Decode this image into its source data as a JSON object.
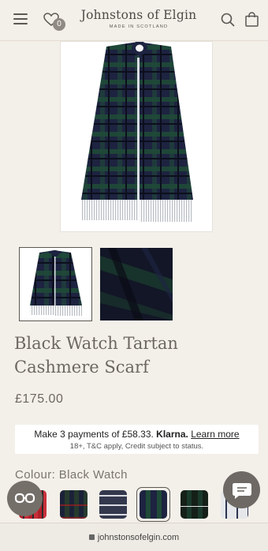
{
  "header": {
    "brand": "Johnstons of Elgin",
    "tagline": "MADE IN SCOTLAND",
    "wishlist_count": "0"
  },
  "product": {
    "title_line1": "Black Watch Tartan",
    "title_line2": "Cashmere Scarf",
    "price": "£175.00"
  },
  "klarna": {
    "prefix": "Make 3 payments of £58.33. ",
    "brand": "Klarna.",
    "link": "Learn more",
    "disclaimer": "18+, T&C apply, Credit subject to status."
  },
  "colour": {
    "label": "Colour: Black Watch"
  },
  "browser": {
    "url": "johnstonsofelgin.com"
  },
  "colors": {
    "background": "#f3efe9",
    "text": "#6c6761",
    "tartan_navy": "#1d2340",
    "tartan_green": "#1f4a38"
  }
}
